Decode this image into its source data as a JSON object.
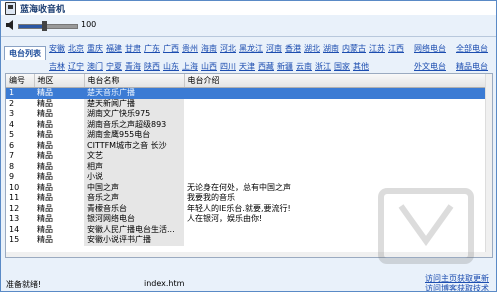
{
  "window": {
    "title": "蓝海收音机"
  },
  "volume": {
    "value": "100",
    "level_fraction": 0.45
  },
  "category_tab": "电台列表",
  "provinces_row1": [
    "安徽",
    "北京",
    "重庆",
    "福建",
    "甘肃",
    "广东",
    "广西",
    "贵州",
    "海南",
    "河北",
    "黑龙江",
    "河南",
    "香港",
    "湖北",
    "湖南",
    "内蒙古",
    "江苏",
    "江西"
  ],
  "provinces_row2": [
    "吉林",
    "辽宁",
    "澳门",
    "宁夏",
    "青海",
    "陕西",
    "山东",
    "上海",
    "山西",
    "四川",
    "天津",
    "西藏",
    "新疆",
    "云南",
    "浙江",
    "国家",
    "其他"
  ],
  "side_links": {
    "network": "网络电台",
    "all": "全部电台",
    "overseas": "外文电台",
    "featured": "精品电台"
  },
  "table": {
    "headers": [
      "编号",
      "地区",
      "电台名称",
      "电台介绍"
    ],
    "rows": [
      {
        "id": "1",
        "region": "精品",
        "name": "楚天音乐广播",
        "desc": ""
      },
      {
        "id": "2",
        "region": "精品",
        "name": "楚天新闻广播",
        "desc": ""
      },
      {
        "id": "3",
        "region": "精品",
        "name": "湖南文广快乐975",
        "desc": ""
      },
      {
        "id": "4",
        "region": "精品",
        "name": "湖南音乐之声超级893",
        "desc": ""
      },
      {
        "id": "5",
        "region": "精品",
        "name": "湖南金鹰955电台",
        "desc": ""
      },
      {
        "id": "6",
        "region": "精品",
        "name": "CITTFM城市之音 长沙",
        "desc": ""
      },
      {
        "id": "7",
        "region": "精品",
        "name": "文艺",
        "desc": ""
      },
      {
        "id": "8",
        "region": "精品",
        "name": "相声",
        "desc": ""
      },
      {
        "id": "9",
        "region": "精品",
        "name": "小说",
        "desc": ""
      },
      {
        "id": "10",
        "region": "精品",
        "name": "中国之声",
        "desc": "无论身在何处，总有中国之声"
      },
      {
        "id": "11",
        "region": "精品",
        "name": "音乐之声",
        "desc": "我要我的音乐"
      },
      {
        "id": "12",
        "region": "精品",
        "name": "青檬音乐台",
        "desc": "年轻人的IE乐台.就要,要流行!"
      },
      {
        "id": "13",
        "region": "精品",
        "name": "银河网络电台",
        "desc": "人在银河，娱乐由你!"
      },
      {
        "id": "14",
        "region": "精品",
        "name": "安徽人民广播电台生活...",
        "desc": ""
      },
      {
        "id": "15",
        "region": "精品",
        "name": "安徽小说评书广播",
        "desc": ""
      }
    ]
  },
  "status": {
    "text": "准备就绪!",
    "page": "index.htm",
    "link_home": "访问主页获取更新",
    "link_blog": "访问博客获取技术"
  }
}
